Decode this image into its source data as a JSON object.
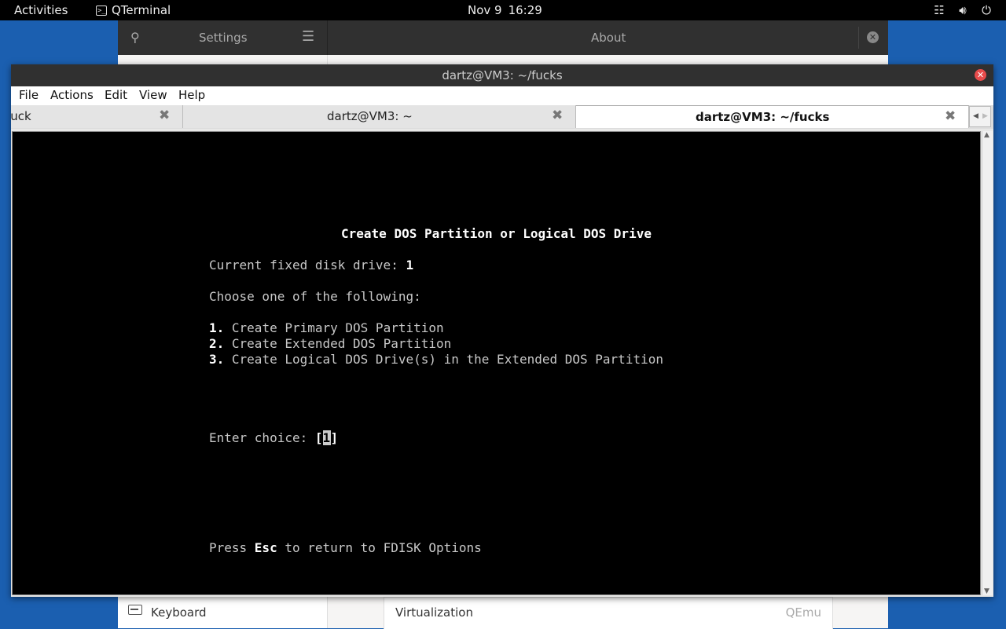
{
  "topbar": {
    "activities": "Activities",
    "app_name": "QTerminal",
    "date": "Nov 9",
    "time": "16:29",
    "tray_icons": [
      "network-icon",
      "volume-icon",
      "power-icon"
    ]
  },
  "settings": {
    "sidebar_title": "Settings",
    "panel_title": "About",
    "sidebar_item": "Keyboard",
    "row_label": "Virtualization",
    "row_value": "QEmu"
  },
  "window": {
    "title": "dartz@VM3: ~/fucks",
    "menus": [
      "File",
      "Actions",
      "Edit",
      "View",
      "Help"
    ],
    "tabs": [
      {
        "label": "fuck",
        "active": false
      },
      {
        "label": "dartz@VM3: ~",
        "active": false
      },
      {
        "label": "dartz@VM3: ~/fucks",
        "active": true
      }
    ]
  },
  "terminal": {
    "title": "Create DOS Partition or Logical DOS Drive",
    "drive_label": "Current fixed disk drive: ",
    "drive_value": "1",
    "prompt": "Choose one of the following:",
    "options": [
      {
        "num": "1.",
        "text": "Create Primary DOS Partition"
      },
      {
        "num": "2.",
        "text": "Create Extended DOS Partition"
      },
      {
        "num": "3.",
        "text": "Create Logical DOS Drive(s) in the Extended DOS Partition"
      }
    ],
    "choice_label": "Enter choice: ",
    "choice_open": "[",
    "choice_value": "1",
    "choice_close": "]",
    "esc_pre": "Press ",
    "esc_key": "Esc",
    "esc_post": " to return to FDISK Options"
  },
  "colors": {
    "desktop": "#1b5fb0",
    "terminal_bg": "#000000",
    "titlebar": "#303030",
    "close_button": "#e84b4b"
  }
}
